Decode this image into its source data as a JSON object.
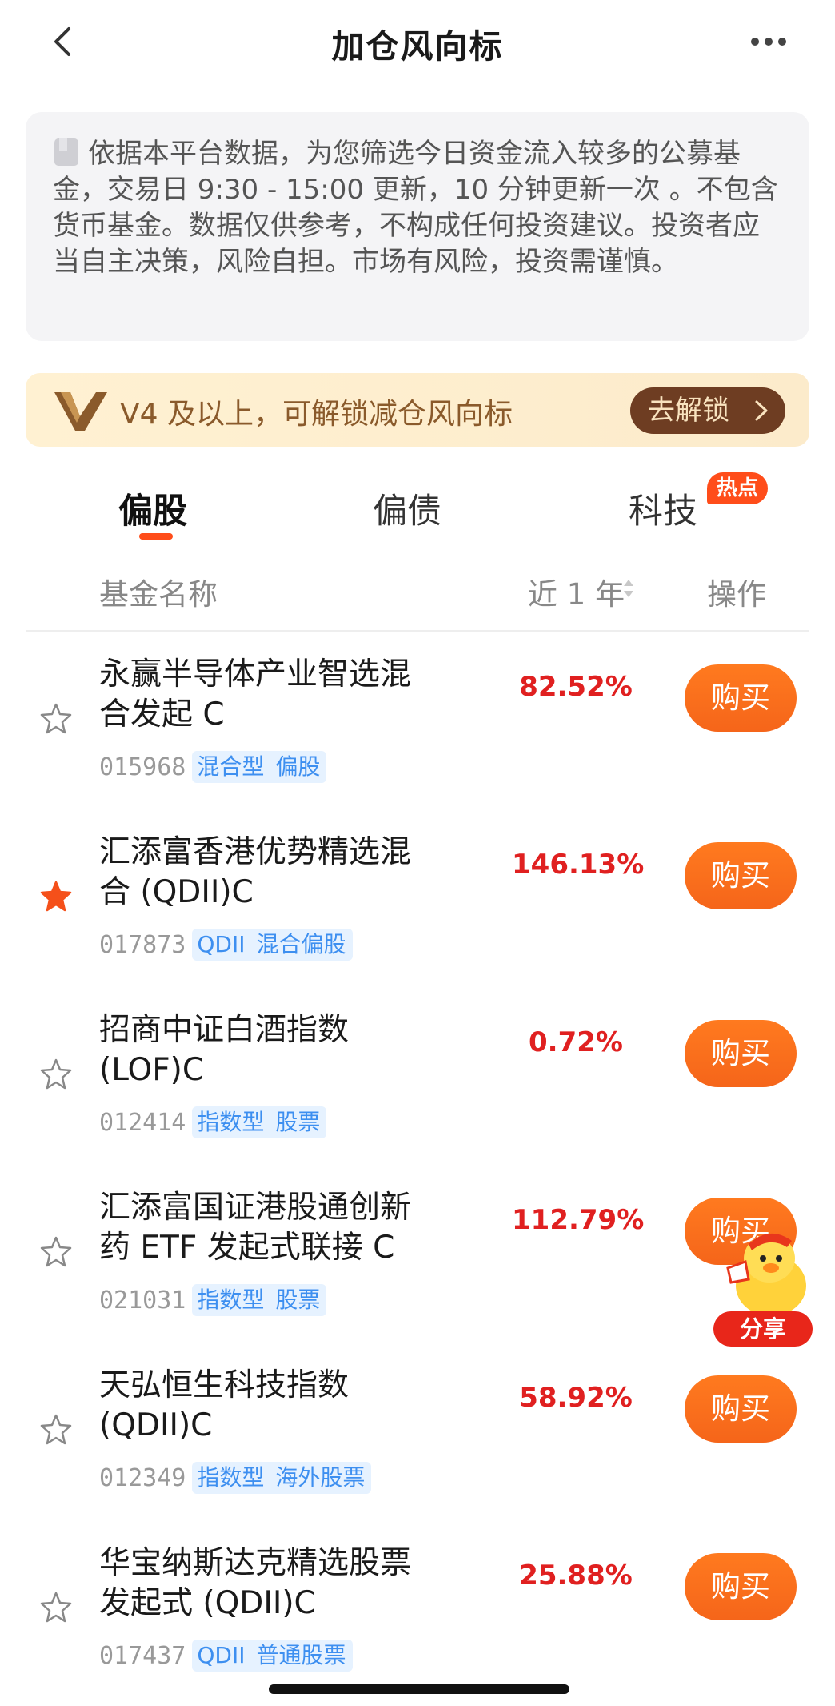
{
  "header": {
    "title": "加仓风向标"
  },
  "notice": {
    "icon": "document-icon",
    "text": "依据本平台数据，为您筛选今日资金流入较多的公募基金，交易日 9:30 - 15:00 更新，10 分钟更新一次 。不包含货币基金。数据仅供参考，不构成任何投资建议。投资者应当自主决策，风险自担。市场有风险，投资需谨慎。"
  },
  "vip_banner": {
    "text": "V4 及以上，可解锁减仓风向标",
    "button_label": "去解锁"
  },
  "tabs": [
    {
      "label": "偏股",
      "active": true
    },
    {
      "label": "偏债",
      "active": false
    },
    {
      "label": "科技",
      "active": false,
      "badge": "热点"
    }
  ],
  "table_header": {
    "name": "基金名称",
    "year": "近 1 年",
    "action": "操作"
  },
  "funds": [
    {
      "name_line1": "永赢半导体产业智选混",
      "name_line2": "合发起 C",
      "code": "015968",
      "tags": [
        "混合型",
        "偏股"
      ],
      "return_1y": "82.52%",
      "starred": false,
      "buy_label": "购买"
    },
    {
      "name_line1": "汇添富香港优势精选混",
      "name_line2": "合 (QDII)C",
      "code": "017873",
      "tags": [
        "QDII",
        "混合偏股"
      ],
      "return_1y": "146.13%",
      "starred": true,
      "buy_label": "购买"
    },
    {
      "name_line1": "招商中证白酒指数",
      "name_line2": "(LOF)C",
      "code": "012414",
      "tags": [
        "指数型",
        "股票"
      ],
      "return_1y": "0.72%",
      "starred": false,
      "buy_label": "购买"
    },
    {
      "name_line1": "汇添富国证港股通创新",
      "name_line2": "药 ETF 发起式联接 C",
      "code": "021031",
      "tags": [
        "指数型",
        "股票"
      ],
      "return_1y": "112.79%",
      "starred": false,
      "buy_label": "购买"
    },
    {
      "name_line1": "天弘恒生科技指数",
      "name_line2": "(QDII)C",
      "code": "012349",
      "tags": [
        "指数型",
        "海外股票"
      ],
      "return_1y": "58.92%",
      "starred": false,
      "buy_label": "购买"
    },
    {
      "name_line1": "华宝纳斯达克精选股票",
      "name_line2": "发起式 (QDII)C",
      "code": "017437",
      "tags": [
        "QDII",
        "普通股票"
      ],
      "return_1y": "25.88%",
      "starred": false,
      "buy_label": "购买"
    }
  ],
  "share_widget": {
    "label": "分享"
  },
  "colors": {
    "accent_orange": "#f5651a",
    "return_red": "#e02020",
    "tag_blue": "#3d8ff0",
    "vip_brown": "#6e3d22"
  }
}
